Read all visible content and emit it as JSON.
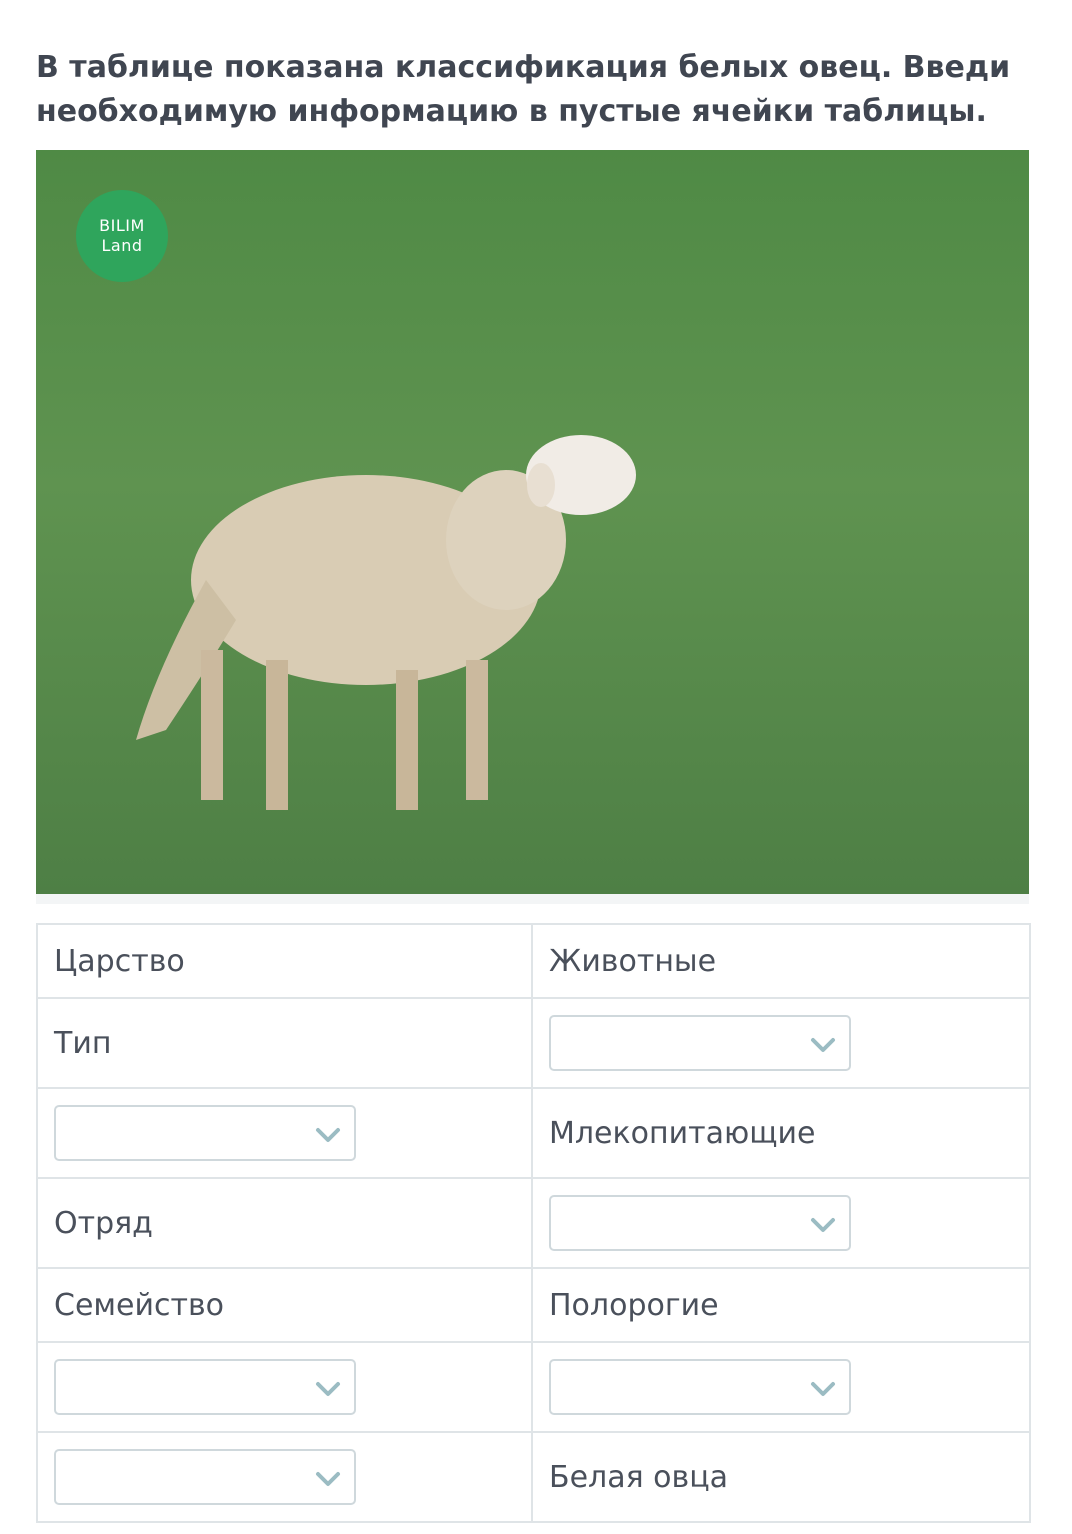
{
  "instruction": "В таблице показана классификация белых овец. Введи необходимую информацию в пустые ячейки таблицы.",
  "photo": {
    "logo_line1": "BILIM",
    "logo_line2": "Land",
    "colors": {
      "grass": "#5d8f4c",
      "logo": "#2fa55c",
      "wool": "#d9ccb4"
    }
  },
  "table": {
    "row1": {
      "left": "Царство",
      "right": "Животные"
    },
    "row2": {
      "left": "Тип",
      "right_select": ""
    },
    "row3": {
      "left_select": "",
      "right": "Млекопитающие"
    },
    "row4": {
      "left": "Отряд",
      "right_select": ""
    },
    "row5": {
      "left": "Семейство",
      "right": "Полорогие"
    },
    "row6": {
      "left_select": "",
      "right_select": ""
    },
    "row7": {
      "left_select": "",
      "right": "Белая овца"
    }
  },
  "icons": {
    "dropdown": "chevron-down-icon"
  }
}
